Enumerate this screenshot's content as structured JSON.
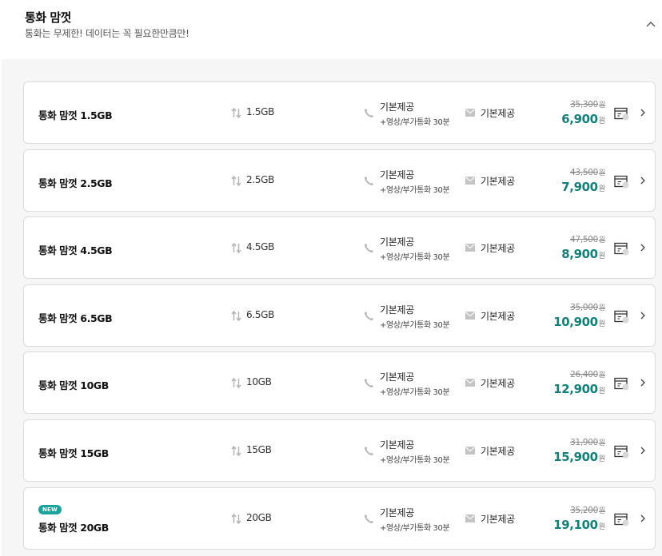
{
  "header": {
    "title": "통화 맘껏",
    "subtitle": "통화는 무제한! 데이터는 꼭 필요한만큼만!"
  },
  "icons": {
    "data": "data-arrows-icon",
    "call": "phone-icon",
    "sms": "envelope-icon",
    "compare": "compare-icon",
    "detail": "chevron-right-icon",
    "collapse": "chevron-up-icon"
  },
  "colors": {
    "accent": "#12807a",
    "badge": "#1aa39a",
    "background": "#f6f6f6"
  },
  "plans": [
    {
      "name": "통화 맘껏 1.5GB",
      "badge": "",
      "data": "1.5GB",
      "call_main": "기본제공",
      "call_sub": "+영상/부가통화 30분",
      "sms": "기본제공",
      "old_price": "35,300",
      "price": "6,900",
      "won": "원"
    },
    {
      "name": "통화 맘껏 2.5GB",
      "badge": "",
      "data": "2.5GB",
      "call_main": "기본제공",
      "call_sub": "+영상/부가통화 30분",
      "sms": "기본제공",
      "old_price": "43,500",
      "price": "7,900",
      "won": "원"
    },
    {
      "name": "통화 맘껏 4.5GB",
      "badge": "",
      "data": "4.5GB",
      "call_main": "기본제공",
      "call_sub": "+영상/부가통화 30분",
      "sms": "기본제공",
      "old_price": "47,500",
      "price": "8,900",
      "won": "원"
    },
    {
      "name": "통화 맘껏 6.5GB",
      "badge": "",
      "data": "6.5GB",
      "call_main": "기본제공",
      "call_sub": "+영상/부가통화 30분",
      "sms": "기본제공",
      "old_price": "35,000",
      "price": "10,900",
      "won": "원"
    },
    {
      "name": "통화 맘껏 10GB",
      "badge": "",
      "data": "10GB",
      "call_main": "기본제공",
      "call_sub": "+영상/부가통화 30분",
      "sms": "기본제공",
      "old_price": "26,400",
      "price": "12,900",
      "won": "원"
    },
    {
      "name": "통화 맘껏 15GB",
      "badge": "",
      "data": "15GB",
      "call_main": "기본제공",
      "call_sub": "+영상/부가통화 30분",
      "sms": "기본제공",
      "old_price": "31,900",
      "price": "15,900",
      "won": "원"
    },
    {
      "name": "통화 맘껏 20GB",
      "badge": "NEW",
      "data": "20GB",
      "call_main": "기본제공",
      "call_sub": "+영상/부가통화 30분",
      "sms": "기본제공",
      "old_price": "35,200",
      "price": "19,100",
      "won": "원"
    }
  ]
}
